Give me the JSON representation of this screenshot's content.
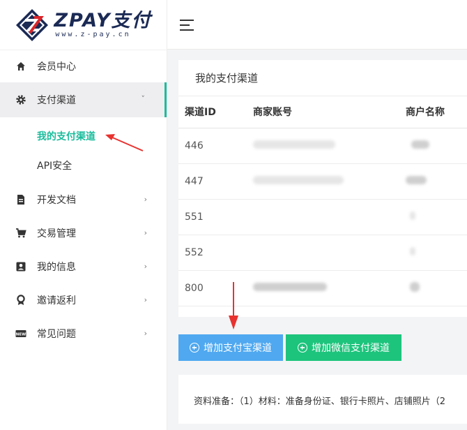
{
  "brand": {
    "title": "ZPAY支付",
    "subtitle": "www.z-pay.cn"
  },
  "sidebar": {
    "items": [
      {
        "label": "会员中心",
        "icon": "home-icon"
      },
      {
        "label": "支付渠道",
        "icon": "gear-icon"
      },
      {
        "label": "开发文档",
        "icon": "document-icon"
      },
      {
        "label": "交易管理",
        "icon": "cart-icon"
      },
      {
        "label": "我的信息",
        "icon": "user-card-icon"
      },
      {
        "label": "邀请返利",
        "icon": "award-icon"
      },
      {
        "label": "常见问题",
        "icon": "new-badge-icon"
      }
    ],
    "subitems": [
      {
        "label": "我的支付渠道"
      },
      {
        "label": "API安全"
      }
    ]
  },
  "card": {
    "title": "我的支付渠道",
    "columns": [
      "渠道ID",
      "商家账号",
      "商户名称"
    ],
    "rows": [
      {
        "id": "446"
      },
      {
        "id": "447"
      },
      {
        "id": "551"
      },
      {
        "id": "552"
      },
      {
        "id": "800"
      }
    ]
  },
  "buttons": {
    "add_alipay": "增加支付宝渠道",
    "add_wechat": "增加微信支付渠道"
  },
  "info": {
    "text": "资料准备：（1）材料：准备身份证、银行卡照片、店铺照片（2"
  },
  "colors": {
    "accent": "#1abc9c",
    "alipay_button": "#4fa8f0",
    "wechat_button": "#1dc47c",
    "annotation_arrow": "#e8322f"
  }
}
